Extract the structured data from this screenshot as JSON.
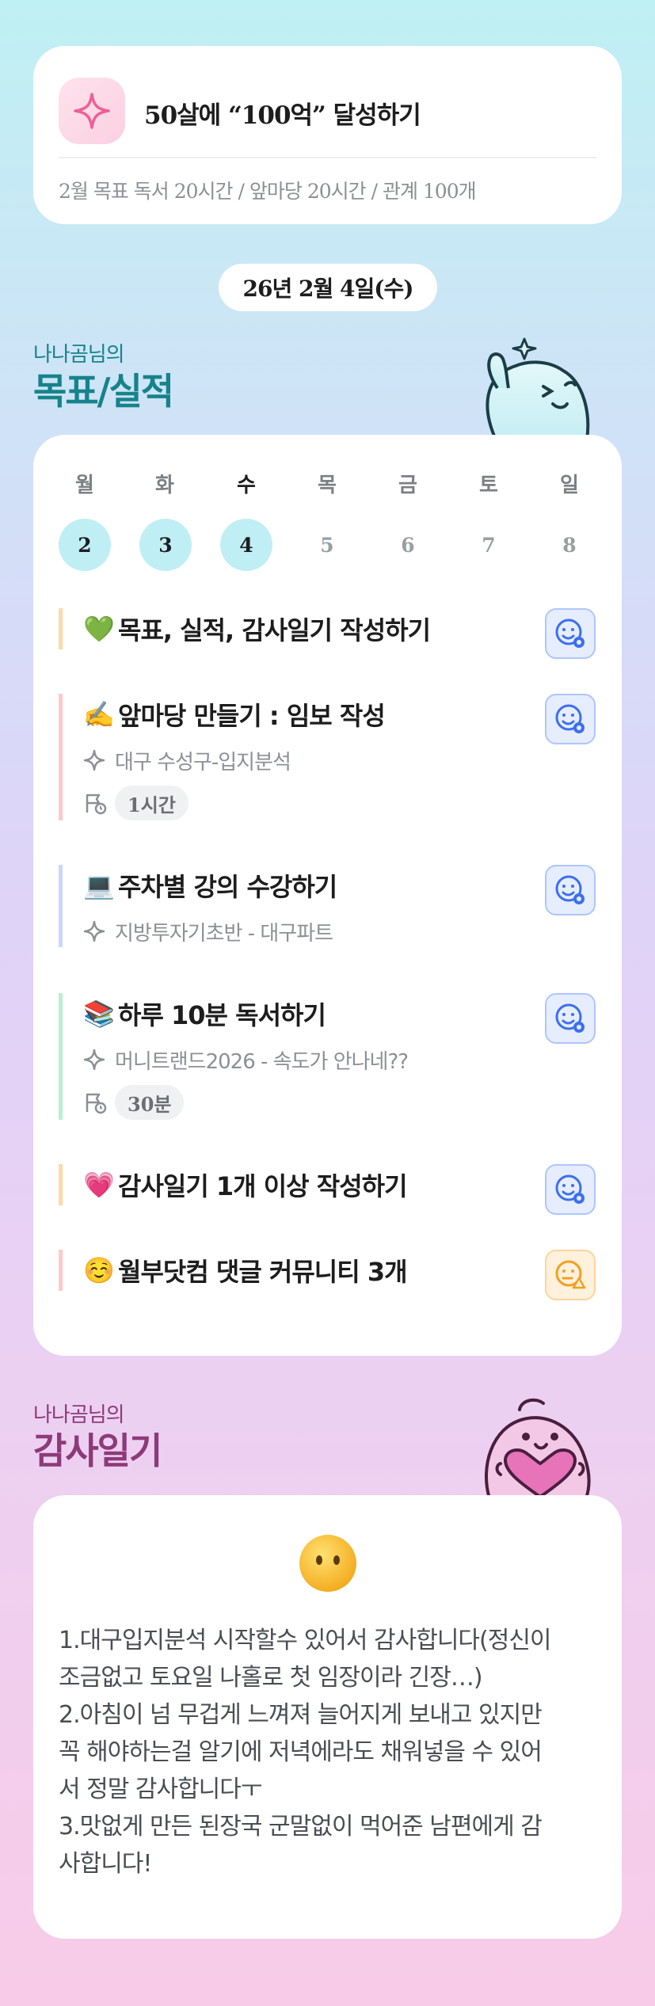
{
  "goal": {
    "title": "50살에 “100억” 달성하기",
    "subtitle": "2월 목표  독서 20시간 / 앞마당 20시간 / 관계 100개"
  },
  "date": "26년 2월 4일(수)",
  "goals_section": {
    "owner": "나나곰님의",
    "title": "목표/실적"
  },
  "week": {
    "labels": [
      "월",
      "화",
      "수",
      "목",
      "금",
      "토",
      "일"
    ],
    "days": [
      "2",
      "3",
      "4",
      "5",
      "6",
      "7",
      "8"
    ],
    "active_index": 2,
    "done_indices": [
      0,
      1,
      2
    ]
  },
  "tasks": [
    {
      "emoji": "💚",
      "title": "목표, 실적, 감사일기 작성하기",
      "color": "#ffd9a8",
      "status": "done"
    },
    {
      "emoji": "✍️",
      "title": "앞마당 만들기 : 임보 작성",
      "sub": "대구 수성구-입지분석",
      "time": "1시간",
      "color": "#ffc9c9",
      "status": "done"
    },
    {
      "emoji": "💻",
      "title": "주차별 강의 수강하기",
      "sub": "지방투자기초반 - 대구파트",
      "color": "#c9d6ff",
      "status": "done"
    },
    {
      "emoji": "📚",
      "title": "하루 10분 독서하기",
      "sub": "머니트랜드2026  - 속도가 안나네??",
      "time": "30분",
      "color": "#bdeed4",
      "status": "done"
    },
    {
      "emoji": "💗",
      "title": "감사일기 1개 이상 작성하기",
      "color": "#ffd9a8",
      "status": "done"
    },
    {
      "emoji": "☺️",
      "title": "월부닷컴 댓글 커뮤니티 3개",
      "color": "#ffc9c9",
      "status": "warn"
    }
  ],
  "gratitude_section": {
    "owner": "나나곰님의",
    "title": "감사일기"
  },
  "gratitude": {
    "text": "1.대구입지분석 시작할수 있어서 감사합니다(정신이\n조금없고 토요일 나홀로 첫 임장이라 긴장…)\n2.아침이 넘 무겁게 느껴져 늘어지게 보내고 있지만\n꼭 해야하는걸 알기에 저녁에라도 채워넣을 수 있어\n서 정말 감사합니다ㅜ\n3.맛없게 만든 된장국 군말없이 먹어준 남편에게 감\n사합니다!"
  }
}
